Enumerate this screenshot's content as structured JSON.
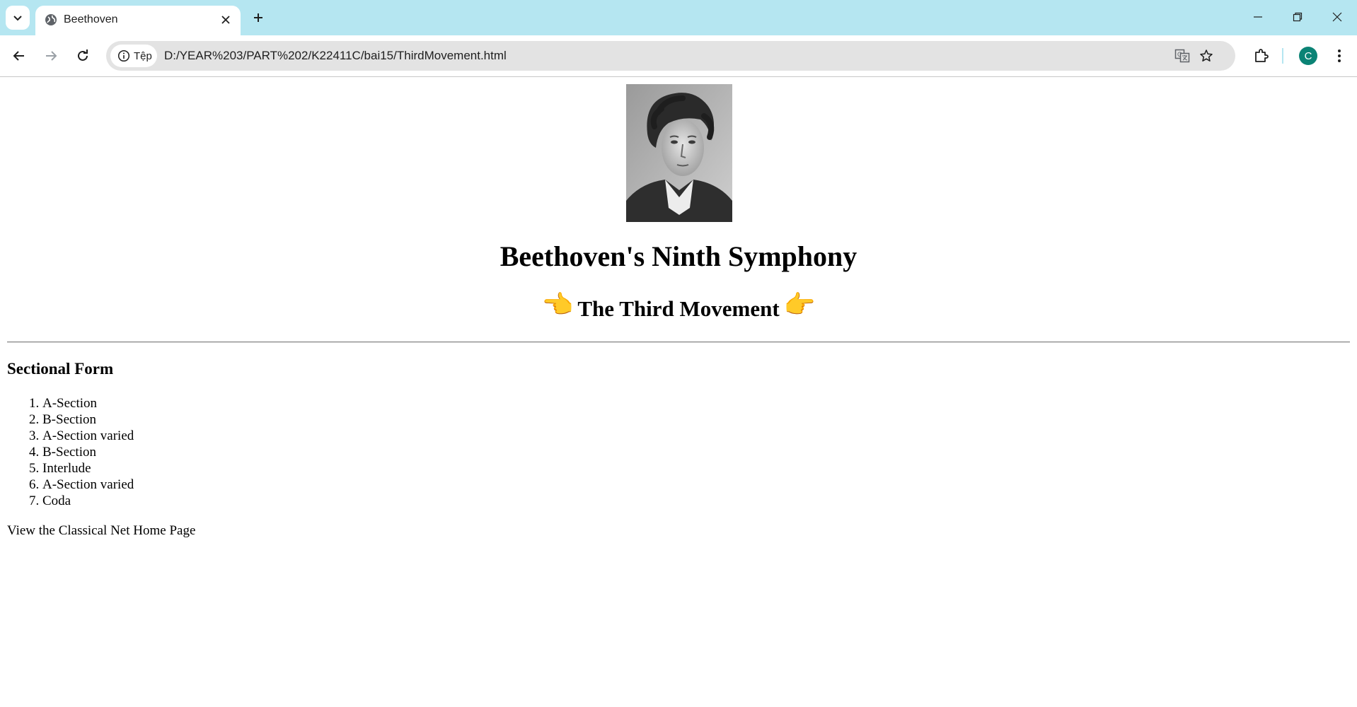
{
  "browser": {
    "tab_title": "Beethoven",
    "site_chip": "Tệp",
    "url": "D:/YEAR%203/PART%202/K22411C/bai15/ThirdMovement.html",
    "profile_initial": "C",
    "accent_color": "#b5e6f1",
    "avatar_color": "#0b8375"
  },
  "page": {
    "title": "Beethoven's Ninth Symphony",
    "subtitle": "The Third Movement",
    "left_hand": "👈",
    "right_hand": "👉",
    "section_heading": "Sectional Form",
    "sections": [
      "A-Section",
      "B-Section",
      "A-Section varied",
      "B-Section",
      "Interlude",
      "A-Section varied",
      "Coda"
    ],
    "home_link": "View the Classical Net Home Page"
  }
}
